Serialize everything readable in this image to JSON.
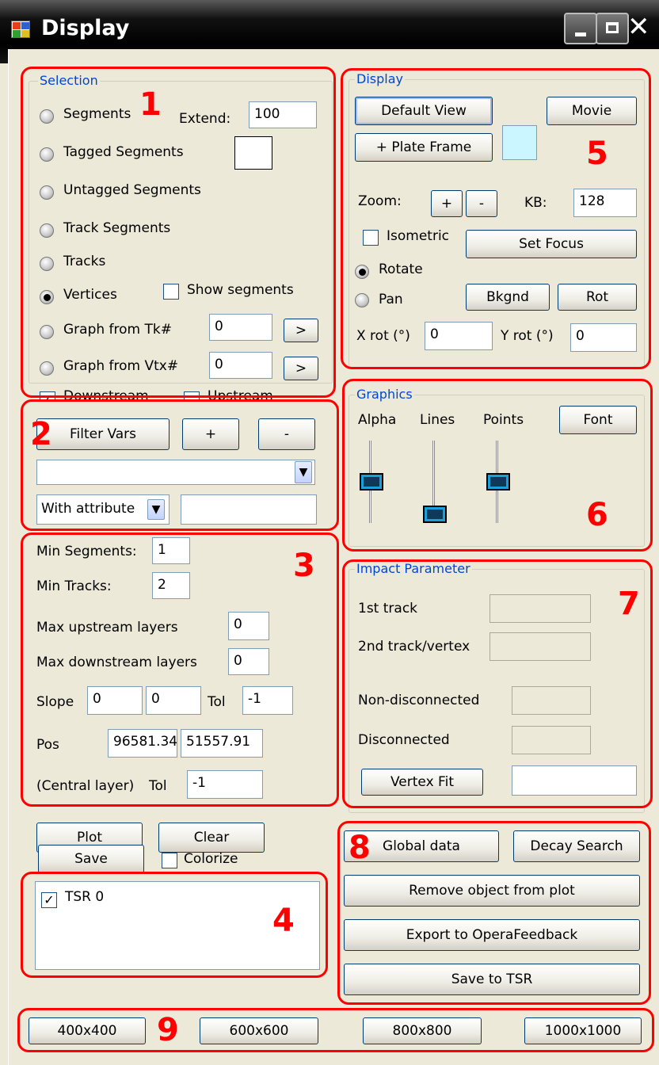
{
  "window": {
    "title": "Display"
  },
  "selection": {
    "title": "Selection",
    "segments": "Segments",
    "extend_label": "Extend:",
    "extend_value": "100",
    "tagged": "Tagged Segments",
    "untagged": "Untagged Segments",
    "track_segments": "Track Segments",
    "tracks": "Tracks",
    "vertices": "Vertices",
    "show_segments": "Show segments",
    "graph_tk": "Graph from Tk#",
    "graph_tk_value": "0",
    "graph_vtx": "Graph from Vtx#",
    "graph_vtx_value": "0",
    "go": ">",
    "downstream": "Downstream",
    "upstream": "Upstream",
    "selected": "Vertices",
    "checked_show_segments": false,
    "checked_downstream": true,
    "checked_upstream": false
  },
  "filter": {
    "filter_vars": "Filter Vars",
    "plus": "+",
    "minus": "-",
    "combo_value": "",
    "attr_combo": "With attribute",
    "attr_value": ""
  },
  "params": {
    "min_segments_label": "Min Segments:",
    "min_segments": "1",
    "min_tracks_label": "Min Tracks:",
    "min_tracks": "2",
    "max_up_label": "Max upstream layers",
    "max_up": "0",
    "max_down_label": "Max downstream layers",
    "max_down": "0",
    "slope_label": "Slope",
    "slope_x": "0",
    "slope_y": "0",
    "tol_label": "Tol",
    "slope_tol": "-1",
    "pos_label": "Pos",
    "pos_x": "96581.34",
    "pos_y": "51557.91",
    "central_label": "(Central layer)",
    "pos_tol": "-1"
  },
  "actions": {
    "plot": "Plot",
    "clear": "Clear",
    "save": "Save",
    "colorize": "Colorize",
    "colorize_checked": false
  },
  "tsr_list": [
    {
      "label": "TSR 0",
      "checked": true
    }
  ],
  "display": {
    "title": "Display",
    "default_view": "Default View",
    "movie": "Movie",
    "plate_frame": "+ Plate Frame",
    "plate_color": "#ccf6ff",
    "zoom_label": "Zoom:",
    "zoom_in": "+",
    "zoom_out": "-",
    "kb_label": "KB:",
    "kb_value": "128",
    "isometric": "Isometric",
    "isometric_checked": false,
    "set_focus": "Set Focus",
    "rotate": "Rotate",
    "pan": "Pan",
    "mode": "Rotate",
    "bkgnd": "Bkgnd",
    "rot": "Rot",
    "xrot_label": "X rot (°)",
    "xrot": "0",
    "yrot_label": "Y rot (°)",
    "yrot": "0"
  },
  "graphics": {
    "title": "Graphics",
    "alpha": "Alpha",
    "lines": "Lines",
    "points": "Points",
    "font": "Font",
    "alpha_level": 0.5,
    "lines_level": 0.0,
    "points_level": 0.5
  },
  "impact": {
    "title": "Impact Parameter",
    "first_track": "1st track",
    "second_track": "2nd track/vertex",
    "non_disconnected": "Non-disconnected",
    "disconnected": "Disconnected",
    "vertex_fit": "Vertex Fit",
    "vertex_fit_value": ""
  },
  "global": {
    "global_data": "Global data",
    "decay_search": "Decay Search",
    "remove_object": "Remove object from plot",
    "export": "Export to OperaFeedback",
    "save_tsr": "Save to TSR"
  },
  "sizes": [
    "400x400",
    "600x600",
    "800x800",
    "1000x1000"
  ],
  "annotations": [
    "1",
    "2",
    "3",
    "4",
    "5",
    "6",
    "7",
    "8",
    "9"
  ],
  "colors": {
    "annotation": "#ff0000",
    "group_title": "#0046d5",
    "background": "#ece9d8"
  }
}
